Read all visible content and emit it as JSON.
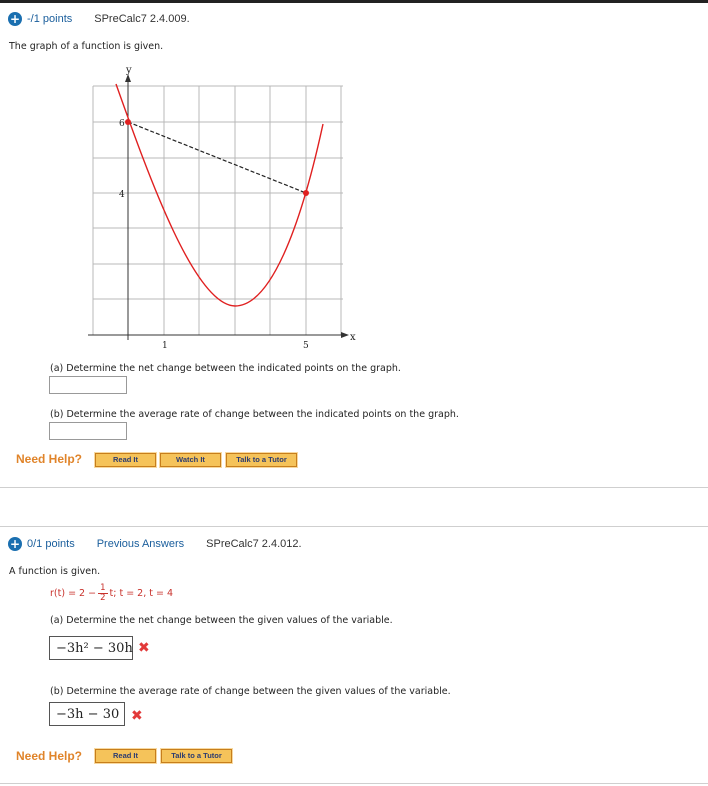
{
  "q1": {
    "points": "-/1 points",
    "code": "SPreCalc7 2.4.009.",
    "prompt": "The graph of a function is given.",
    "graph": {
      "y_axis_label": "y",
      "x_axis_label": "x",
      "x_ticks": [
        "1",
        "5"
      ],
      "y_ticks": [
        "6",
        "4"
      ],
      "points": [
        {
          "x": 0,
          "y": 6
        },
        {
          "x": 5,
          "y": 4
        }
      ]
    },
    "part_a": "(a) Determine the net change between the indicated points on the graph.",
    "part_a_value": "",
    "part_b": "(b) Determine the average rate of change between the indicated points on the graph.",
    "part_b_value": "",
    "need_help": "Need Help?",
    "buttons": [
      "Read It",
      "Watch It",
      "Talk to a Tutor"
    ]
  },
  "q2": {
    "points": "0/1 points",
    "previous": "Previous Answers",
    "code": "SPreCalc7 2.4.012.",
    "prompt": "A function is given.",
    "func_lhs": "r(t) = 2 −",
    "frac_num": "1",
    "frac_den": "2",
    "func_rest": "t;   t = 2, t = 4",
    "part_a": "(a) Determine the net change between the given values of the variable.",
    "answer_a": "−3h² − 30h",
    "part_b": "(b) Determine the average rate of change between the given values of the variable.",
    "answer_b": "−3h − 30",
    "wrong_mark": "✖",
    "need_help": "Need Help?",
    "buttons": [
      "Read It",
      "Talk to a Tutor"
    ]
  },
  "colors": {
    "accent": "#1a6fb0",
    "curve": "#e02020",
    "help": "#e0842a",
    "button": "#f5c35a",
    "wrong": "#e23a3a"
  }
}
